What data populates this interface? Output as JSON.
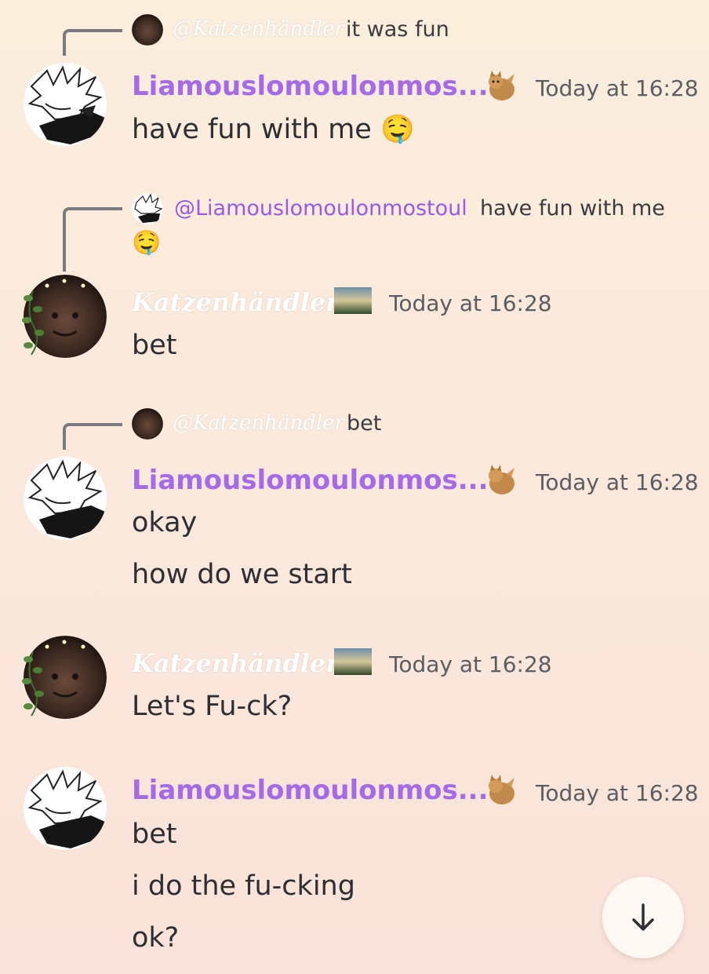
{
  "messages": [
    {
      "reply": {
        "author": "@Katzenhändler",
        "text": "it was fun"
      },
      "author": "Liamouslomoulonmos...",
      "timestamp": "Today at 16:28",
      "lines": [
        "have fun with me 🤤"
      ]
    },
    {
      "reply": {
        "author": "@Liamouslomoulonmostoul",
        "text": "have fun with me",
        "emoji": "🤤"
      },
      "author": "Katzenhändler",
      "timestamp": "Today at 16:28",
      "lines": [
        "bet"
      ]
    },
    {
      "reply": {
        "author": "@Katzenhändler",
        "text": "bet"
      },
      "author": "Liamouslomoulonmos...",
      "timestamp": "Today at 16:28",
      "lines": [
        "okay",
        "how do we start"
      ]
    },
    {
      "author": "Katzenhändler",
      "timestamp": "Today at 16:28",
      "lines": [
        "Let's Fu-ck?"
      ]
    },
    {
      "author": "Liamouslomoulonmos...",
      "timestamp": "Today at 16:28",
      "lines": [
        "bet",
        "i do the fu-cking",
        "ok?"
      ]
    }
  ],
  "colors": {
    "username_purple": "#a56ae6",
    "mention_purple": "#9b59e6",
    "timestamp": "#5c5c63"
  },
  "icons": {
    "scroll_down": "arrow-down-icon"
  }
}
